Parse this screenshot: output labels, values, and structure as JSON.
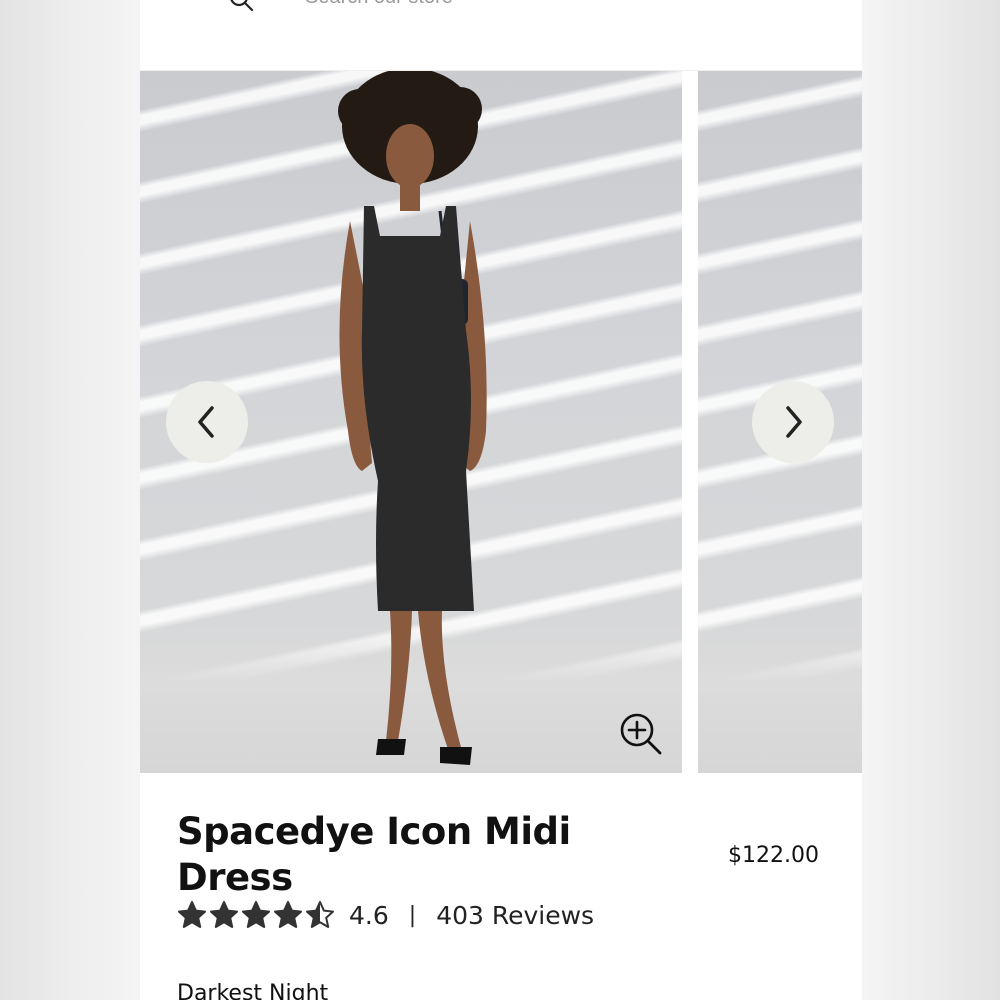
{
  "search": {
    "placeholder": "Search our store"
  },
  "gallery": {
    "prev_icon": "chevron-left-icon",
    "next_icon": "chevron-right-icon",
    "zoom_icon": "zoom-in-icon"
  },
  "product": {
    "title": "Spacedye Icon Midi Dress",
    "price": "$122.00",
    "rating": 4.6,
    "rating_label": "4.6",
    "separator": "|",
    "reviews_label": "403 Reviews",
    "color_name": "Darkest Night"
  },
  "colors": {
    "text": "#111111",
    "nav_button_bg": "#ededea",
    "dress": "#2b2b2b"
  }
}
